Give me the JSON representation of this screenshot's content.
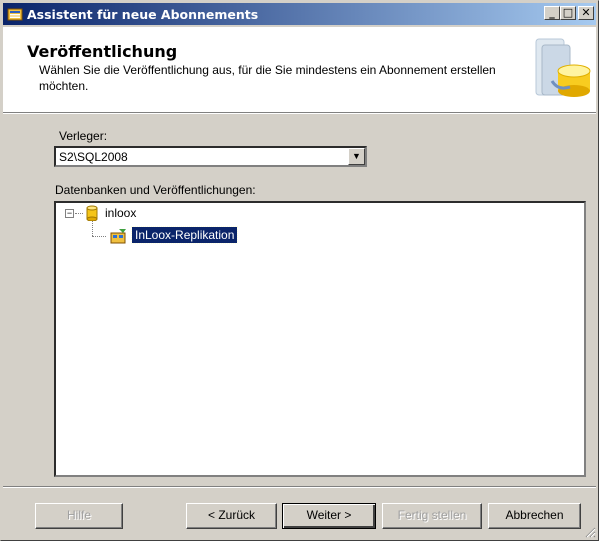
{
  "window": {
    "title": "Assistent für neue Abonnements",
    "minimize": "_",
    "maximize": "□",
    "close": "✕"
  },
  "header": {
    "title": "Veröffentlichung",
    "description": "Wählen Sie die Veröffentlichung aus, für die Sie mindestens ein Abonnement erstellen möchten."
  },
  "form": {
    "publisher_label": "Verleger:",
    "publisher_value": "S2\\SQL2008",
    "tree_label": "Datenbanken und Veröffentlichungen:",
    "tree": {
      "expander": "−",
      "database": "inloox",
      "publication": "InLoox-Replikation"
    }
  },
  "buttons": {
    "help": "Hilfe",
    "back": "< Zurück",
    "next": "Weiter >",
    "finish": "Fertig stellen",
    "cancel": "Abbrechen"
  },
  "colors": {
    "selection": "#0a246a",
    "titlebar_start": "#0a246a",
    "titlebar_end": "#a6caf0"
  }
}
